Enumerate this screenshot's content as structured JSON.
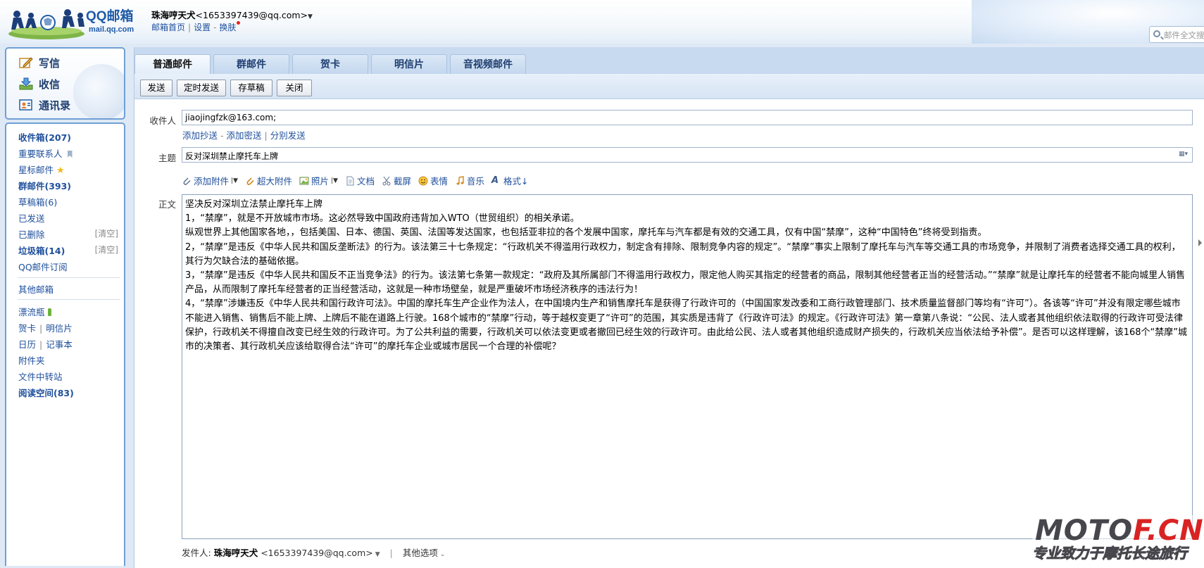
{
  "header": {
    "logo_text": "QQ邮箱",
    "logo_sub": "mail.qq.com",
    "account_name": "珠海哼天犬",
    "account_email": "<1653397439@qq.com>",
    "links": [
      "邮箱首页",
      "设置",
      "换肤"
    ],
    "search_placeholder": "邮件全文搜索"
  },
  "sidebar": {
    "quick": [
      "写信",
      "收信",
      "通讯录"
    ],
    "folders": [
      {
        "label": "收件箱(207)",
        "bold": true
      },
      {
        "label": "重要联系人"
      },
      {
        "label": "星标邮件"
      },
      {
        "label": "群邮件(393)",
        "bold": true
      },
      {
        "label": "草稿箱(6)"
      },
      {
        "label": "已发送"
      },
      {
        "label": "已删除",
        "action": "[清空]"
      },
      {
        "label": "垃圾箱(14)",
        "bold": true,
        "action": "[清空]"
      },
      {
        "label": "QQ邮件订阅"
      },
      {
        "label": "其他邮箱"
      },
      {
        "label": "漂流瓶"
      },
      {
        "label": "贺卡",
        "label2": "明信片"
      },
      {
        "label": "日历",
        "label2": "记事本"
      },
      {
        "label": "附件夹"
      },
      {
        "label": "文件中转站"
      },
      {
        "label": "阅读空间(83)",
        "bold": true
      }
    ]
  },
  "tabs": [
    "普通邮件",
    "群邮件",
    "贺卡",
    "明信片",
    "音视频邮件"
  ],
  "toolbar": [
    "发送",
    "定时发送",
    "存草稿",
    "关闭"
  ],
  "compose": {
    "to_label": "收件人",
    "to_value": "jiaojingfzk@163.com;",
    "cc_links": [
      "添加抄送",
      "添加密送",
      "分别发送"
    ],
    "subject_label": "主题",
    "subject_value": "反对深圳禁止摩托车上牌",
    "attach_items": [
      "添加附件",
      "超大附件",
      "照片",
      "文档",
      "截屏",
      "表情",
      "音乐",
      "格式↓"
    ],
    "body_label": "正文",
    "body_lines": [
      "坚决反对深圳立法禁止摩托车上牌",
      "1，“禁摩”，就是不开放城市市场。这必然导致中国政府违背加入WTO（世贸组织）的相关承诺。",
      "纵观世界上其他国家各地，，包括美国、日本、德国、英国、法国等发达国家，也包括亚非拉的各个发展中国家，摩托车与汽车都是有效的交通工具，仅有中国“禁摩”，这种“中国特色”终将受到指责。",
      "2，“禁摩”是违反《中华人民共和国反垄断法》的行为。该法第三十七条规定：“行政机关不得滥用行政权力，制定含有排除、限制竞争内容的规定”。“禁摩”事实上限制了摩托车与汽车等交通工具的市场竞争，并限制了消费者选择交通工具的权利，其行为欠缺合法的基础依据。",
      "3，“禁摩”是违反《中华人民共和国反不正当竞争法》的行为。该法第七条第一款规定：“政府及其所属部门不得滥用行政权力，限定他人购买其指定的经营者的商品，限制其他经营者正当的经营活动。”“禁摩”就是让摩托车的经营者不能向城里人销售产品，从而限制了摩托车经营者的正当经营活动，这就是一种市场壁垒，就是严重破坏市场经济秩序的违法行为！",
      "4，“禁摩”涉嫌违反《中华人民共和国行政许可法》。中国的摩托车生产企业作为法人，在中国境内生产和销售摩托车是获得了行政许可的（中国国家发改委和工商行政管理部门、技术质量监督部门等均有“许可”）。各该等“许可”并没有限定哪些城市不能进入销售、销售后不能上牌、上牌后不能在道路上行驶。168个城市的“禁摩”行动，等于越权变更了“许可”的范围，其实质是违背了《行政许可法》的规定。《行政许可法》第一章第八条说：“公民、法人或者其他组织依法取得的行政许可受法律保护，行政机关不得擅自改变已经生效的行政许可。为了公共利益的需要，行政机关可以依法变更或者撤回已经生效的行政许可。由此给公民、法人或者其他组织造成财产损失的，行政机关应当依法给予补偿”。是否可以这样理解，该168个“禁摩”城市的决策者、其行政机关应该给取得合法“许可”的摩托车企业或城市居民一个合理的补偿呢？"
    ],
    "sender_label": "发件人:",
    "sender_name": "珠海哼天犬",
    "sender_email": "<1653397439@qq.com>",
    "other_options": "其他选项"
  },
  "watermark": {
    "main_a": "MOTO",
    "main_b": "F.CN",
    "sub": "专业致力于摩托长途旅行"
  }
}
